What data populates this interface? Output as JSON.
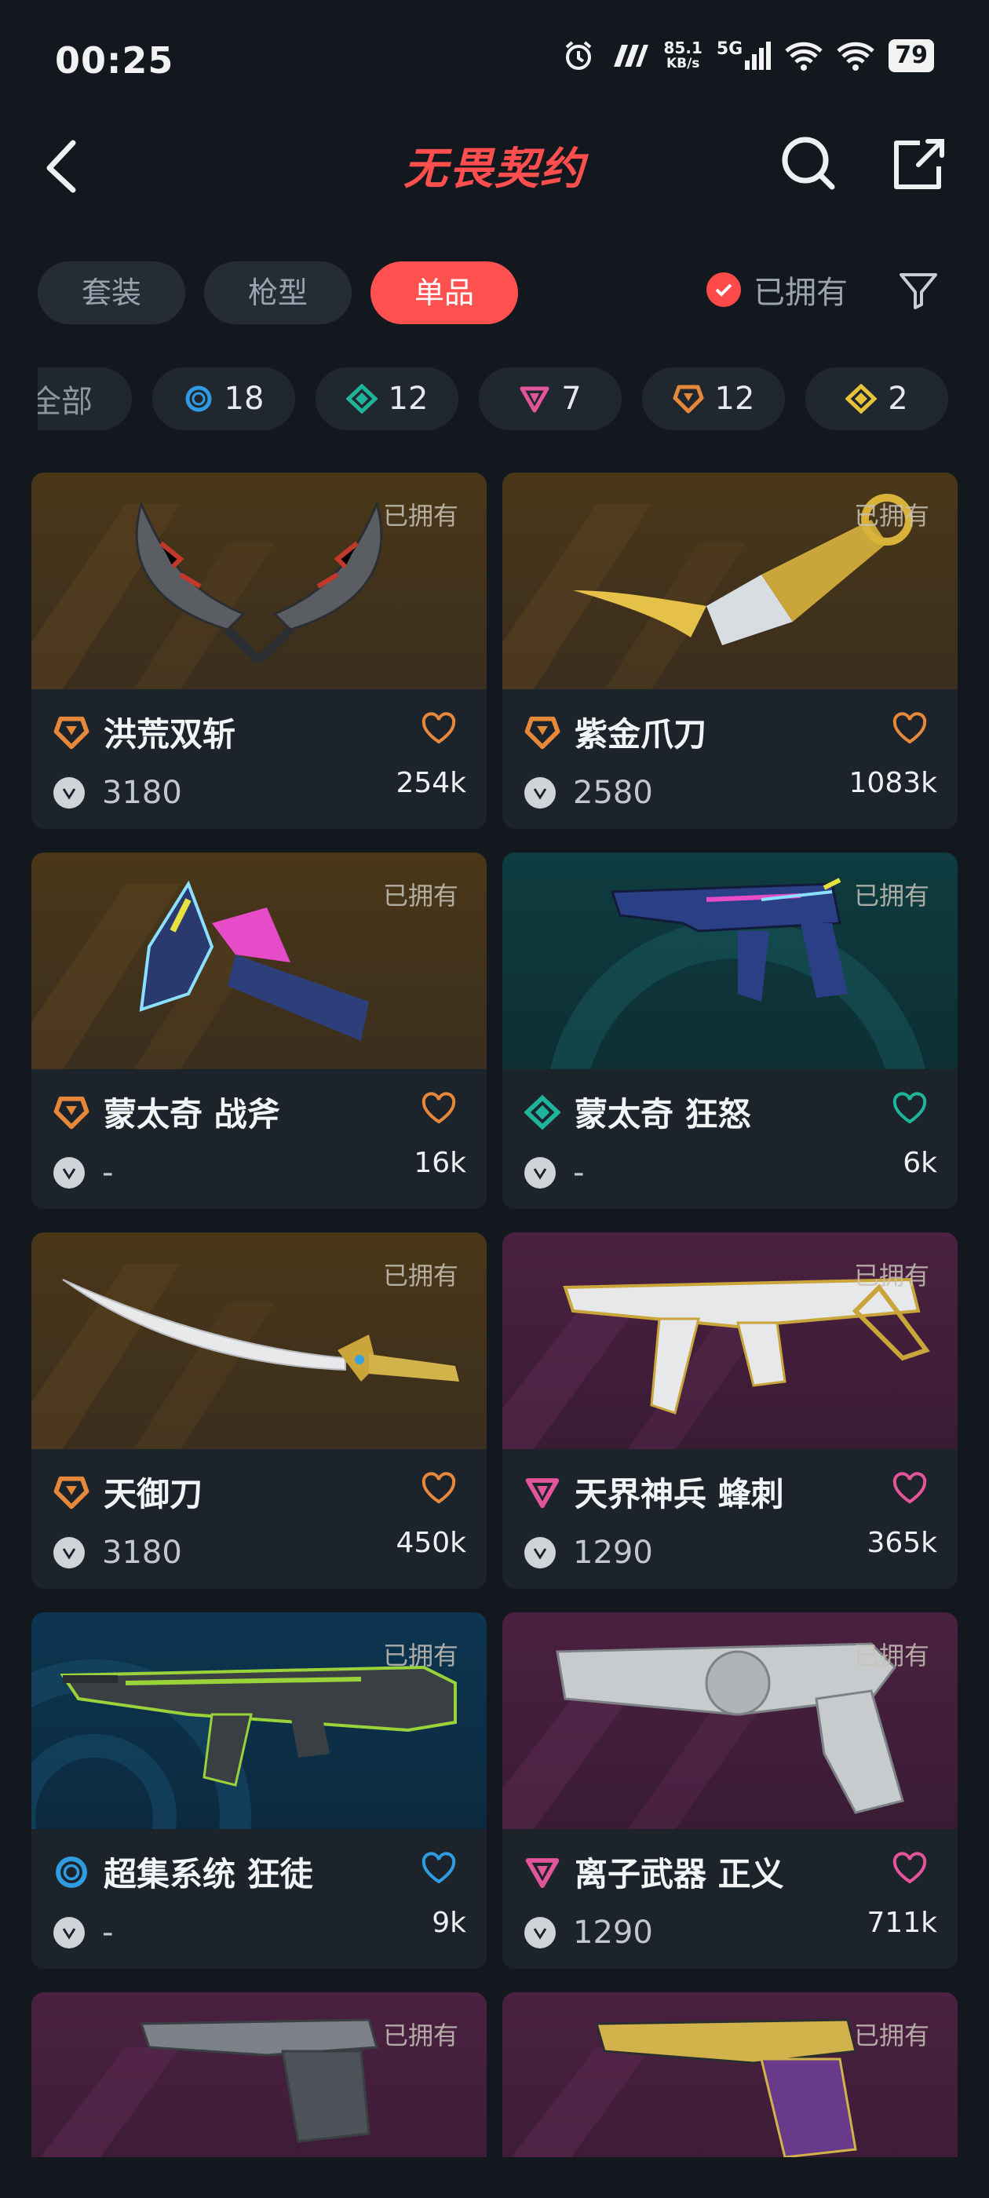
{
  "status": {
    "time": "00:25",
    "net_speed_top": "85.1",
    "net_speed_unit": "KB/s",
    "signal_label": "5G",
    "battery": "79"
  },
  "header": {
    "title": "无畏契约"
  },
  "tabs": [
    {
      "label": "套装",
      "active": false
    },
    {
      "label": "枪型",
      "active": false
    },
    {
      "label": "单品",
      "active": true
    }
  ],
  "owned_filter": {
    "label": "已拥有",
    "checked": true
  },
  "chips": [
    {
      "label": "全部",
      "icon": "all"
    },
    {
      "label": "18",
      "icon": "blue-circle-icon",
      "color": "#2f9be0"
    },
    {
      "label": "12",
      "icon": "teal-diamond-icon",
      "color": "#1fb39a"
    },
    {
      "label": "7",
      "icon": "pink-triangle-icon",
      "color": "#e2559a"
    },
    {
      "label": "12",
      "icon": "orange-pentagon-icon",
      "color": "#e6883a"
    },
    {
      "label": "2",
      "icon": "gold-diamond-icon",
      "color": "#e8c23a"
    }
  ],
  "cards": [
    {
      "name": "洪荒双斩",
      "price": "3180",
      "likes": "254k",
      "owned_label": "已拥有",
      "rarity": "orange",
      "bg": "orange"
    },
    {
      "name": "紫金爪刀",
      "price": "2580",
      "likes": "1083k",
      "owned_label": "已拥有",
      "rarity": "orange",
      "bg": "orange"
    },
    {
      "name": "蒙太奇 战斧",
      "price": "-",
      "likes": "16k",
      "owned_label": "已拥有",
      "rarity": "orange",
      "bg": "orange"
    },
    {
      "name": "蒙太奇 狂怒",
      "price": "-",
      "likes": "6k",
      "owned_label": "已拥有",
      "rarity": "teal",
      "bg": "teal"
    },
    {
      "name": "天御刀",
      "price": "3180",
      "likes": "450k",
      "owned_label": "已拥有",
      "rarity": "orange",
      "bg": "orange"
    },
    {
      "name": "天界神兵 蜂刺",
      "price": "1290",
      "likes": "365k",
      "owned_label": "已拥有",
      "rarity": "pink",
      "bg": "purple"
    },
    {
      "name": "超集系统 狂徒",
      "price": "-",
      "likes": "9k",
      "owned_label": "已拥有",
      "rarity": "blue",
      "bg": "blue"
    },
    {
      "name": "离子武器 正义",
      "price": "1290",
      "likes": "711k",
      "owned_label": "已拥有",
      "rarity": "pink",
      "bg": "purple"
    },
    {
      "owned_label": "已拥有",
      "bg": "purple"
    },
    {
      "owned_label": "已拥有",
      "bg": "purple"
    }
  ],
  "colors": {
    "accent": "#ff5150",
    "orange": "#e6883a",
    "teal": "#1fb39a",
    "pink": "#e2559a",
    "blue": "#2f9be0"
  }
}
